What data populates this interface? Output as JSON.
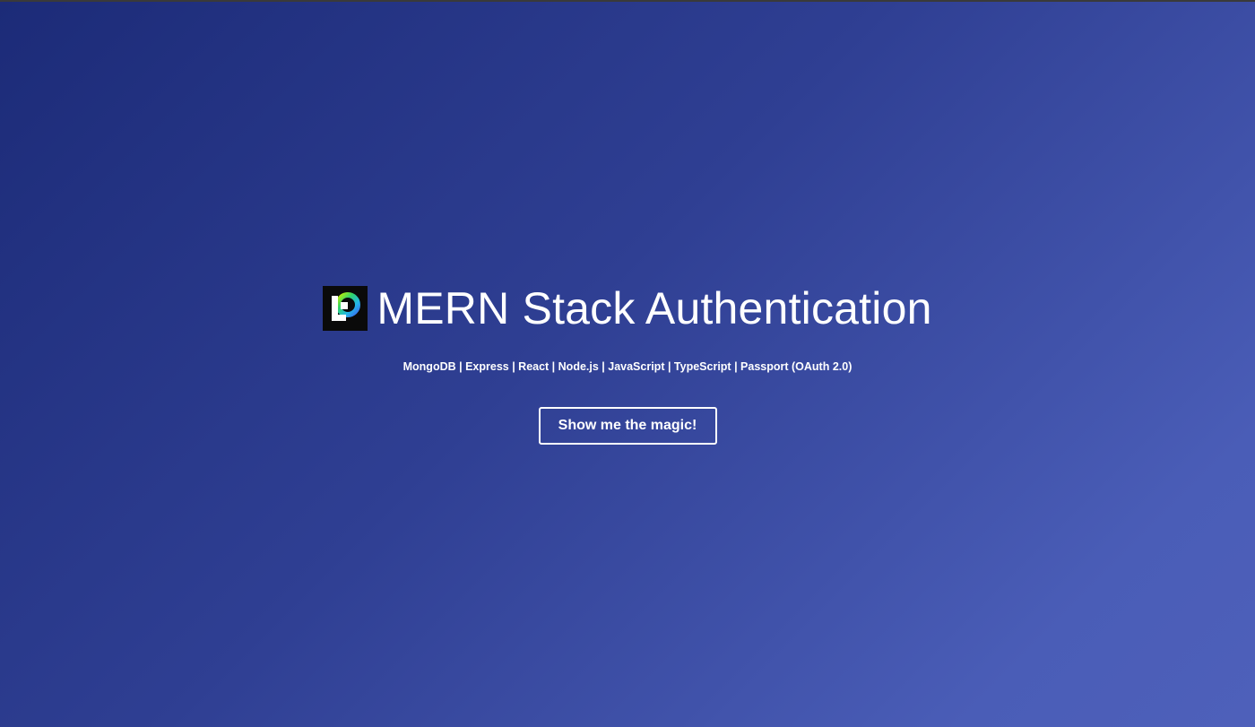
{
  "hero": {
    "logo_icon": "lp-logo-icon",
    "title": "MERN Stack Authentication",
    "subtitle": "MongoDB | Express | React | Node.js | JavaScript | TypeScript | Passport (OAuth 2.0)",
    "cta_label": "Show me the magic!"
  },
  "colors": {
    "background_start": "#1c2b78",
    "background_end": "#4e60ba",
    "text": "#ffffff",
    "logo_background": "#0a0a0a"
  }
}
